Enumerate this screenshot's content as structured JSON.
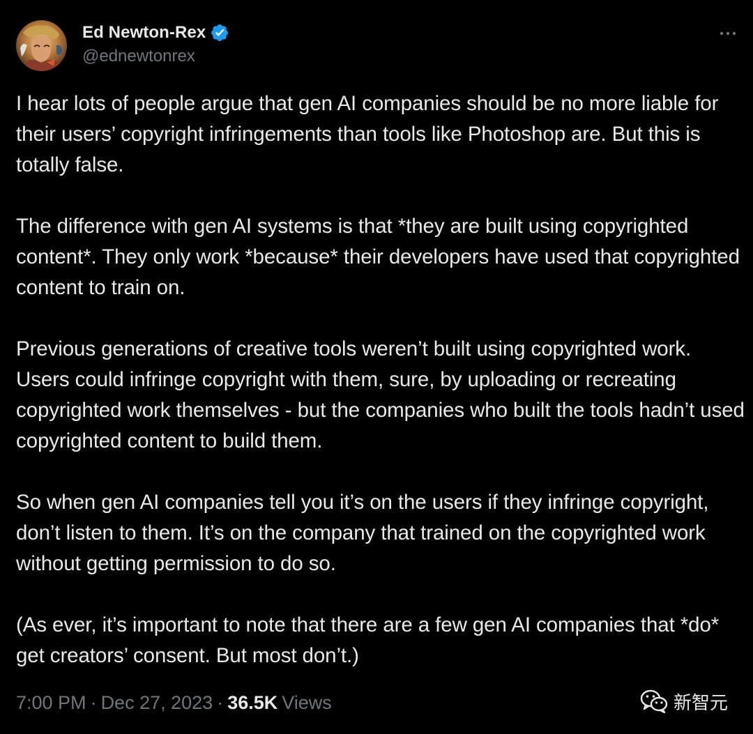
{
  "author": {
    "display_name": "Ed Newton-Rex",
    "handle": "@ednewtonrex",
    "verified": true,
    "verified_color": "#1d9bf0"
  },
  "icons": {
    "avatar": "avatar-image",
    "verified": "verified-badge-icon",
    "more": "more-options-icon",
    "watermark": "wechat-icon"
  },
  "tweet": {
    "paragraphs": [
      "I hear lots of people argue that gen AI companies should be no more liable for their users’ copyright infringements than tools like Photoshop are. But this is totally false.",
      "The difference with gen AI systems is that *they are built using copyrighted content*. They only work *because* their developers have used that copyrighted content to train on.",
      "Previous generations of creative tools weren’t built using copyrighted work. Users could infringe copyright with them, sure, by uploading or recreating copyrighted work themselves - but the companies who built the tools hadn’t used copyrighted content to build them.",
      "So when gen AI companies tell you it’s on the users if they infringe copyright, don’t listen to them. It’s on the company that trained on the copyrighted work without getting permission to do so.",
      "(As ever, it’s important to note that there are a few gen AI companies that *do* get creators’ consent. But most don’t.)"
    ],
    "time": "7:00 PM",
    "separator": "·",
    "date": "Dec 27, 2023",
    "views_count": "36.5K",
    "views_label": "Views"
  },
  "watermark": {
    "text": "新智元"
  },
  "colors": {
    "background": "#000000",
    "text_primary": "#e7e9ea",
    "text_secondary": "#71767b",
    "accent": "#1d9bf0"
  }
}
